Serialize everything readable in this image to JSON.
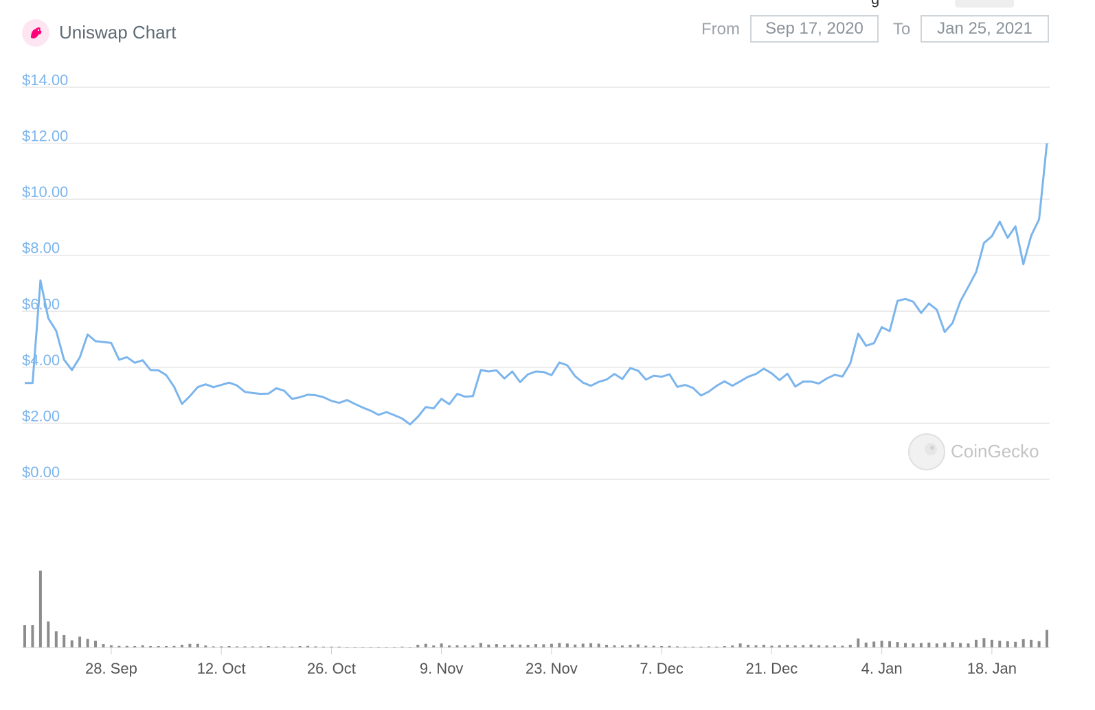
{
  "header": {
    "title": "Uniswap Chart",
    "from_label": "From",
    "from_value": "Sep 17, 2020",
    "to_label": "To",
    "to_value": "Jan 25, 2021",
    "cropped_top_text": "g"
  },
  "watermark": {
    "text": "CoinGecko"
  },
  "colors": {
    "line": "#7cb5ec",
    "volume": "#8c8c8c",
    "grid": "#e6e6e6",
    "axis_label": "#7cb5ec"
  },
  "chart_data": {
    "type": "line",
    "y_ticks": [
      "$0.00",
      "$2.00",
      "$4.00",
      "$6.00",
      "$8.00",
      "$10.00",
      "$12.00",
      "$14.00"
    ],
    "ylim": [
      0,
      14
    ],
    "x_ticks": [
      "28. Sep",
      "12. Oct",
      "26. Oct",
      "9. Nov",
      "23. Nov",
      "7. Dec",
      "21. Dec",
      "4. Jan",
      "18. Jan"
    ],
    "x_start": "2020-09-17",
    "x_end": "2021-01-25",
    "price": [
      3.44,
      3.44,
      7.1,
      5.75,
      5.3,
      4.27,
      3.9,
      4.35,
      5.17,
      4.93,
      4.9,
      4.87,
      4.27,
      4.36,
      4.16,
      4.25,
      3.9,
      3.89,
      3.72,
      3.3,
      2.69,
      2.97,
      3.29,
      3.39,
      3.29,
      3.37,
      3.45,
      3.35,
      3.12,
      3.08,
      3.05,
      3.06,
      3.25,
      3.16,
      2.87,
      2.93,
      3.02,
      3.0,
      2.93,
      2.8,
      2.73,
      2.83,
      2.69,
      2.56,
      2.45,
      2.3,
      2.4,
      2.29,
      2.17,
      1.96,
      2.23,
      2.58,
      2.53,
      2.87,
      2.68,
      3.05,
      2.95,
      2.97,
      3.9,
      3.85,
      3.89,
      3.6,
      3.85,
      3.47,
      3.75,
      3.85,
      3.83,
      3.72,
      4.17,
      4.07,
      3.68,
      3.45,
      3.34,
      3.48,
      3.56,
      3.76,
      3.58,
      3.97,
      3.88,
      3.56,
      3.7,
      3.66,
      3.75,
      3.3,
      3.37,
      3.26,
      2.99,
      3.13,
      3.34,
      3.5,
      3.34,
      3.5,
      3.66,
      3.76,
      3.95,
      3.78,
      3.54,
      3.77,
      3.31,
      3.49,
      3.49,
      3.42,
      3.6,
      3.73,
      3.67,
      4.14,
      5.2,
      4.77,
      4.86,
      5.43,
      5.29,
      6.37,
      6.44,
      6.34,
      5.94,
      6.28,
      6.05,
      5.26,
      5.58,
      6.36,
      6.87,
      7.4,
      8.44,
      8.68,
      9.2,
      8.62,
      9.03,
      7.68,
      8.7,
      9.28,
      12.0
    ],
    "volume": [
      1.0,
      1.0,
      3.4,
      1.15,
      0.72,
      0.55,
      0.32,
      0.48,
      0.38,
      0.3,
      0.15,
      0.1,
      0.07,
      0.07,
      0.06,
      0.1,
      0.06,
      0.06,
      0.06,
      0.07,
      0.12,
      0.16,
      0.16,
      0.09,
      0.05,
      0.05,
      0.06,
      0.05,
      0.05,
      0.05,
      0.05,
      0.06,
      0.04,
      0.05,
      0.04,
      0.06,
      0.07,
      0.05,
      0.04,
      0.04,
      0.04,
      0.03,
      0.03,
      0.03,
      0.03,
      0.03,
      0.03,
      0.03,
      0.04,
      0.03,
      0.12,
      0.16,
      0.09,
      0.18,
      0.09,
      0.1,
      0.1,
      0.09,
      0.2,
      0.13,
      0.15,
      0.12,
      0.13,
      0.13,
      0.12,
      0.15,
      0.14,
      0.16,
      0.2,
      0.18,
      0.13,
      0.17,
      0.19,
      0.17,
      0.12,
      0.1,
      0.09,
      0.12,
      0.14,
      0.08,
      0.08,
      0.06,
      0.07,
      0.05,
      0.04,
      0.04,
      0.04,
      0.05,
      0.04,
      0.06,
      0.09,
      0.18,
      0.12,
      0.1,
      0.12,
      0.08,
      0.1,
      0.12,
      0.09,
      0.11,
      0.13,
      0.1,
      0.09,
      0.09,
      0.08,
      0.12,
      0.4,
      0.22,
      0.26,
      0.3,
      0.28,
      0.24,
      0.2,
      0.18,
      0.2,
      0.22,
      0.18,
      0.22,
      0.24,
      0.2,
      0.18,
      0.34,
      0.42,
      0.34,
      0.3,
      0.28,
      0.25,
      0.37,
      0.34,
      0.28,
      0.78
    ]
  }
}
